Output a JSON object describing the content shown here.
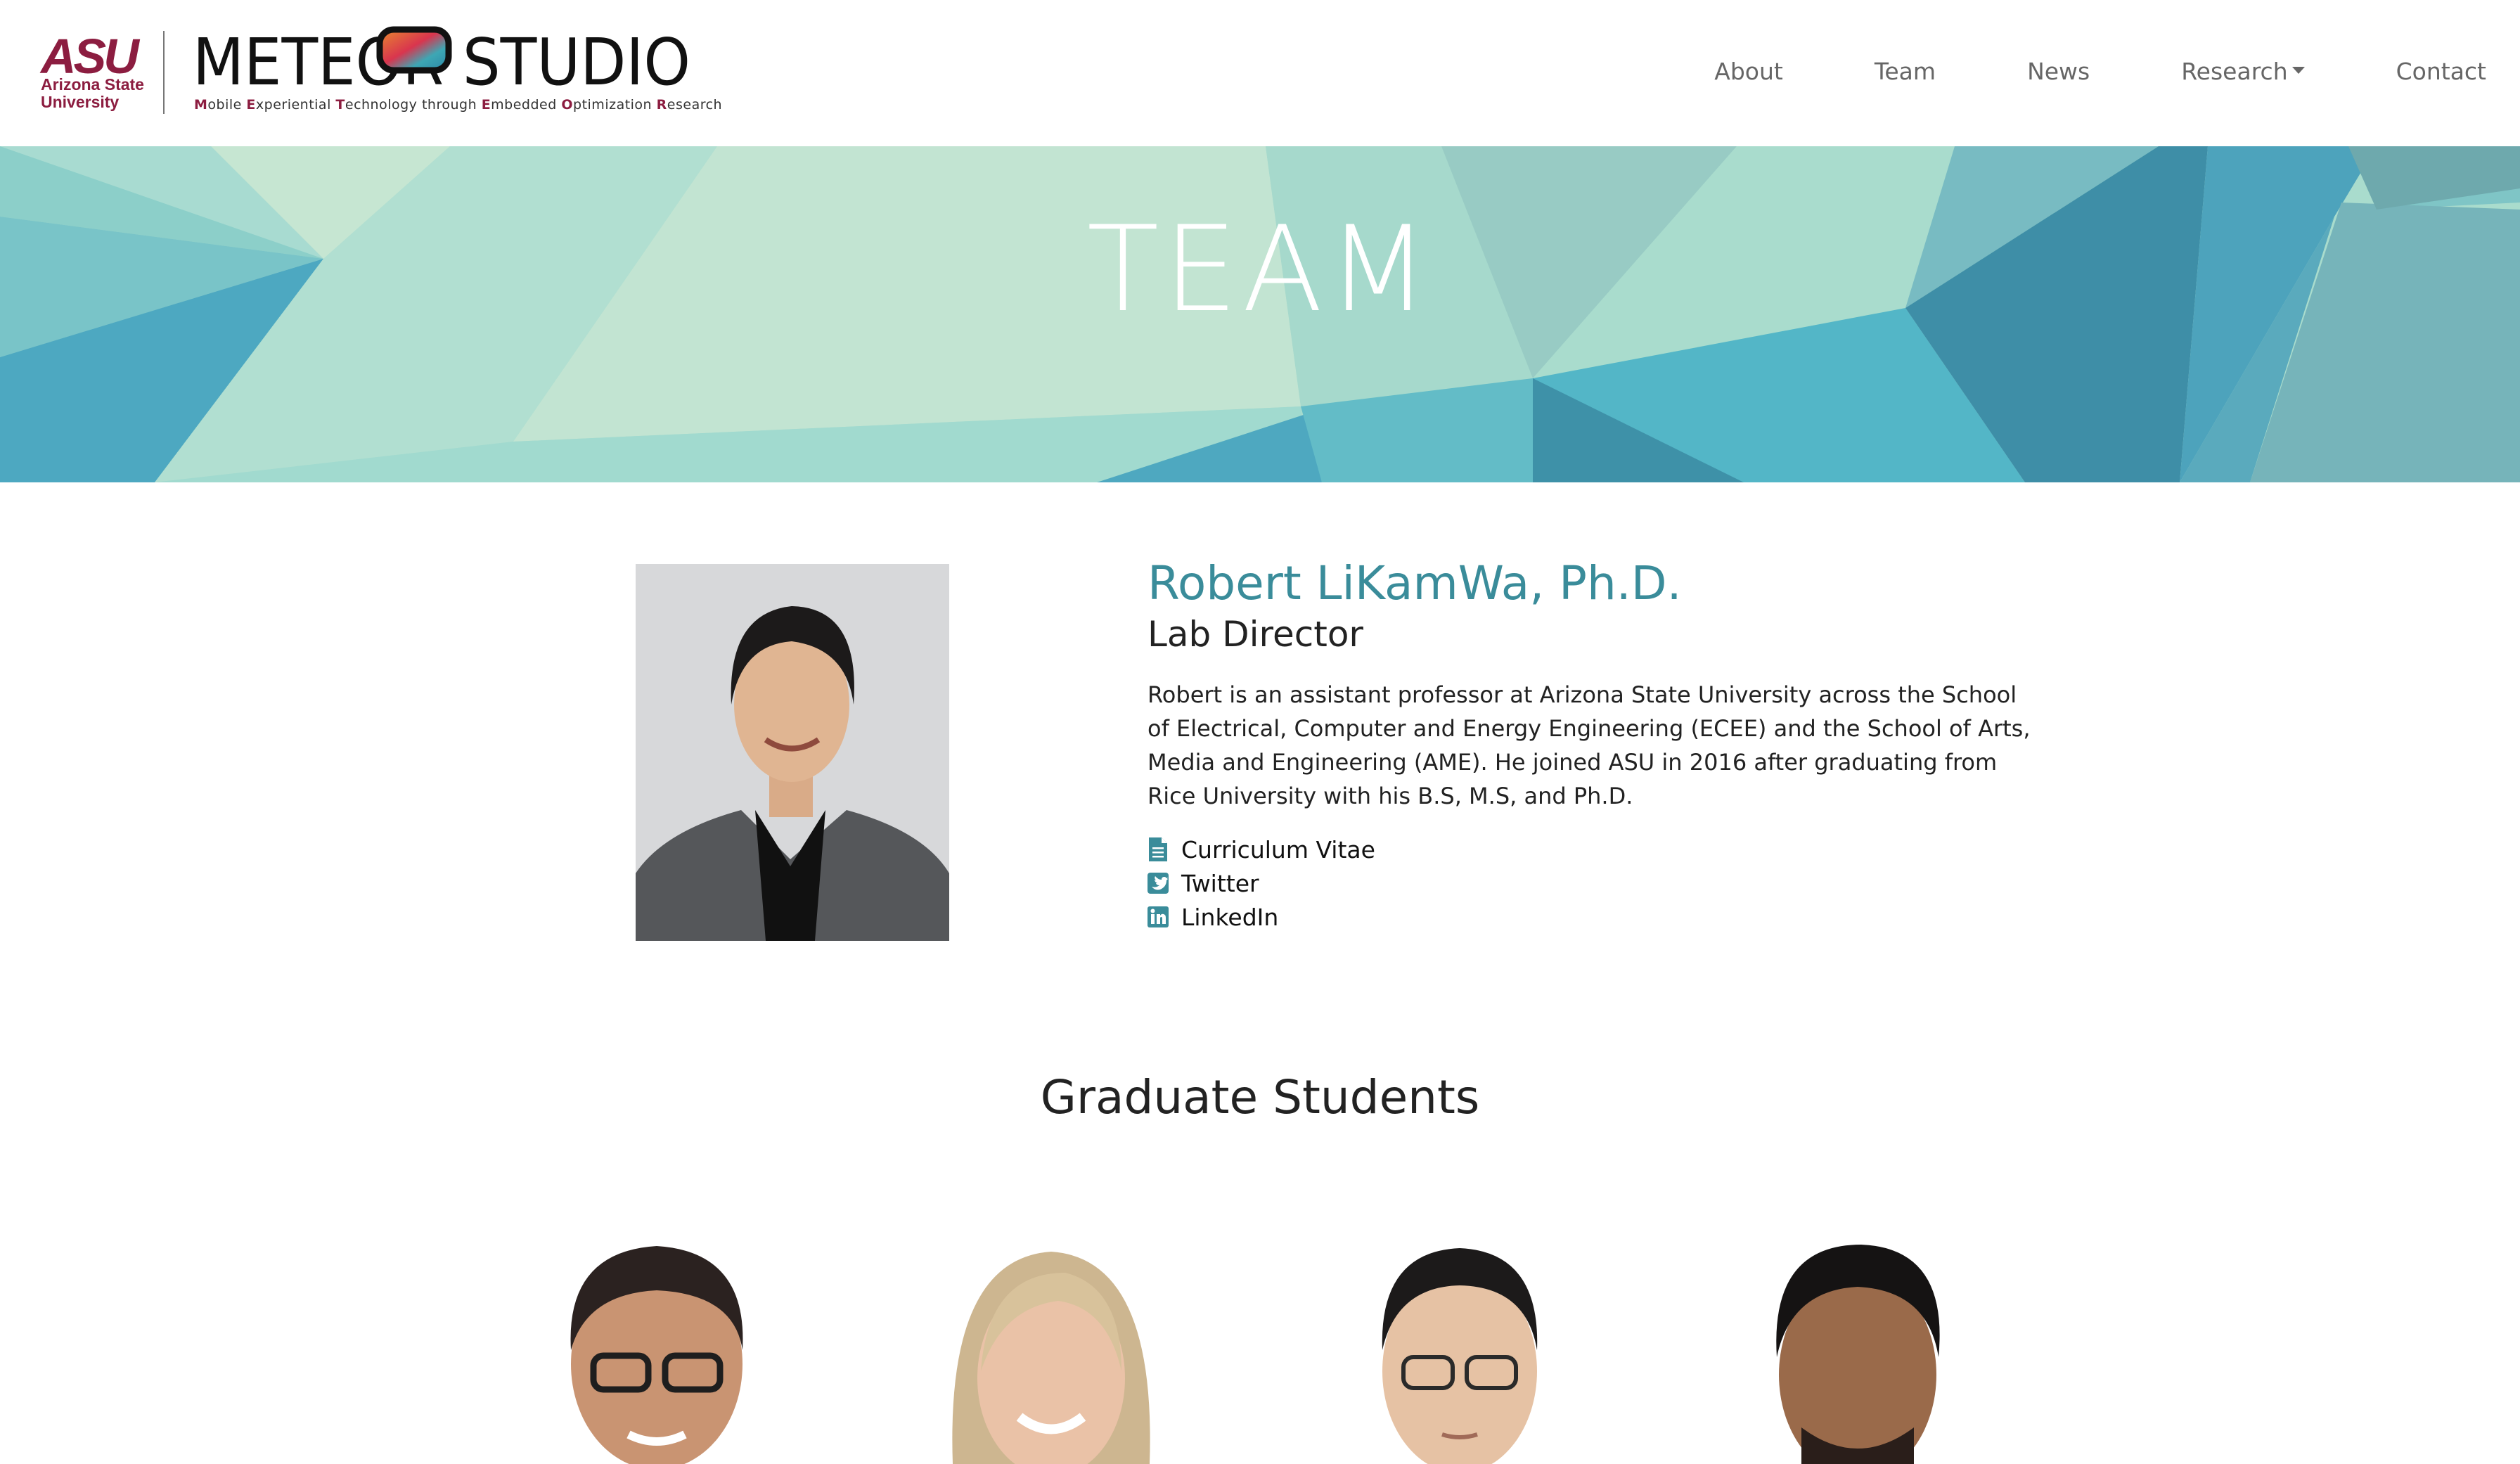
{
  "header": {
    "asu_logo_text": "ASU",
    "asu_name": "Arizona State University",
    "brand_name": "METEOR STUDIO",
    "brand_tagline": "Mobile Experiential Technology through Embedded Optimization Research",
    "nav": [
      {
        "label": "About"
      },
      {
        "label": "Team"
      },
      {
        "label": "News"
      },
      {
        "label": "Research",
        "has_dropdown": true
      },
      {
        "label": "Contact"
      }
    ]
  },
  "banner": {
    "title": "TEAM"
  },
  "director": {
    "name": "Robert LiKamWa, Ph.D.",
    "role": "Lab Director",
    "bio": "Robert is an assistant professor at Arizona State University across the School of Electrical, Computer and Energy Engineering (ECEE) and the School of Arts, Media and Engineering (AME). He joined ASU in 2016 after graduating from Rice University with his B.S, M.S, and Ph.D.",
    "links": [
      {
        "label": "Curriculum Vitae",
        "icon": "document-icon"
      },
      {
        "label": "Twitter",
        "icon": "twitter-icon"
      },
      {
        "label": "LinkedIn",
        "icon": "linkedin-icon"
      }
    ]
  },
  "graduate": {
    "section_title": "Graduate Students"
  },
  "colors": {
    "accent": "#3a8c9a",
    "asu_maroon": "#8c1d40",
    "asu_gold": "#ffc627",
    "nav_text": "#666666"
  }
}
